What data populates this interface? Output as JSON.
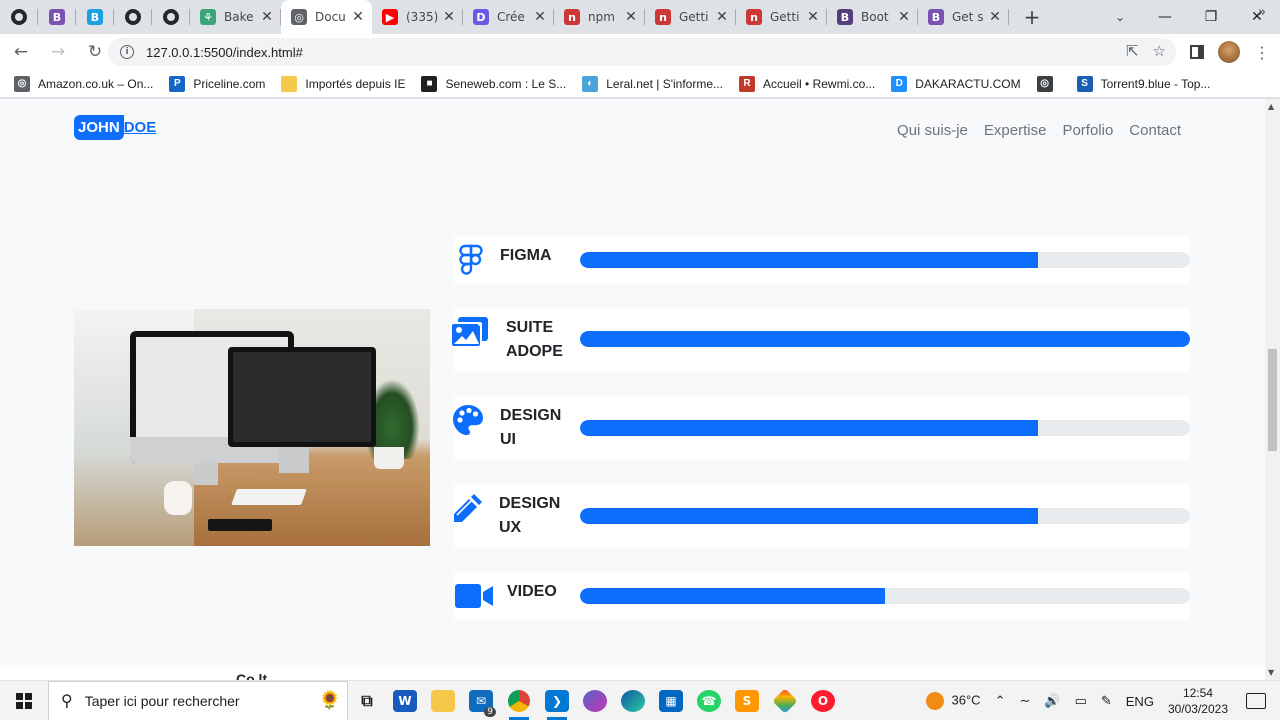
{
  "browser": {
    "tabs": [
      {
        "kind": "pinned",
        "icon": "github-icon"
      },
      {
        "kind": "pinned",
        "icon": "bootstrap-icon",
        "color": "#7952b3",
        "letter": "B"
      },
      {
        "kind": "pinned",
        "icon": "bootstrap-cyan-icon",
        "color": "#1ba1e2",
        "letter": "B"
      },
      {
        "kind": "pinned",
        "icon": "github-icon"
      },
      {
        "kind": "pinned",
        "icon": "github-icon"
      },
      {
        "kind": "tab",
        "title": "Bake",
        "icon": "bake-icon",
        "color": "#3aa675",
        "letter": "⚘"
      },
      {
        "kind": "tab",
        "title": "Docu",
        "icon": "globe-icon",
        "color": "#5f6368",
        "letter": "◎",
        "active": true
      },
      {
        "kind": "tab",
        "title": "(335)",
        "icon": "youtube-icon",
        "color": "#ff0000",
        "letter": "▶"
      },
      {
        "kind": "tab",
        "title": "Crée",
        "icon": "dev-icon",
        "color": "#6e59e6",
        "letter": "D"
      },
      {
        "kind": "tab",
        "title": "npm",
        "icon": "npm-icon",
        "color": "#cb3837",
        "letter": "n"
      },
      {
        "kind": "tab",
        "title": "Getti",
        "icon": "npm-icon",
        "color": "#cb3837",
        "letter": "n"
      },
      {
        "kind": "tab",
        "title": "Getti",
        "icon": "npm-icon",
        "color": "#cb3837",
        "letter": "n"
      },
      {
        "kind": "tab",
        "title": "Boot",
        "icon": "bootstrap-icon",
        "color": "#563d7c",
        "letter": "B"
      },
      {
        "kind": "tab",
        "title": "Get s",
        "icon": "bootstrap-icon",
        "color": "#7952b3",
        "letter": "B"
      }
    ],
    "url": "127.0.0.1:5500/index.html#",
    "bookmarks": [
      {
        "label": "Amazon.co.uk – On...",
        "icon": "globe-icon",
        "color": "#5f6368",
        "letter": "◎"
      },
      {
        "label": "Priceline.com",
        "icon": "priceline-icon",
        "color": "#1666c5",
        "letter": "P"
      },
      {
        "label": "Importés depuis IE",
        "icon": "folder-icon",
        "color": "#f5c84c",
        "letter": ""
      },
      {
        "label": "Seneweb.com : Le S...",
        "icon": "seneweb-icon",
        "color": "#202020",
        "letter": "■"
      },
      {
        "label": "Leral.net | S'informe...",
        "icon": "leral-icon",
        "color": "#4aa3d8",
        "letter": "◐"
      },
      {
        "label": "Accueil • Rewmi.co...",
        "icon": "rewmi-icon",
        "color": "#c0392b",
        "letter": "R"
      },
      {
        "label": "DAKARACTU.COM",
        "icon": "dakaractu-icon",
        "color": "#1e90ff",
        "letter": "D"
      },
      {
        "label": "",
        "icon": "globe-icon",
        "color": "#3c4043",
        "letter": "◎"
      },
      {
        "label": "Torrent9.blue - Top...",
        "icon": "torrent9-icon",
        "color": "#1a5fb4",
        "letter": "S"
      }
    ]
  },
  "page": {
    "brand": {
      "part1": "JOHN",
      "part2": "DOE"
    },
    "nav": [
      "Qui suis-je",
      "Expertise",
      "Porfolio",
      "Contact"
    ],
    "skills": [
      {
        "label": "FIGMA",
        "icon": "figma-icon",
        "level": 0.75
      },
      {
        "label": "SUITE ADOPE",
        "icon": "images-icon",
        "level": 1.0
      },
      {
        "label": "DESIGN UI",
        "icon": "palette-icon",
        "level": 0.75
      },
      {
        "label": "DESIGN UX",
        "icon": "pen-icon",
        "level": 0.75
      },
      {
        "label": "VIDEO",
        "icon": "video-camera-icon",
        "level": 0.5
      }
    ],
    "accent": "#0d6efd",
    "below_peek": "Co   lt"
  },
  "taskbar": {
    "search_placeholder": "Taper ici pour rechercher",
    "temperature": "36°C",
    "language": "ENG",
    "time": "12:54",
    "date": "30/03/2023",
    "mail_badge": "9"
  }
}
